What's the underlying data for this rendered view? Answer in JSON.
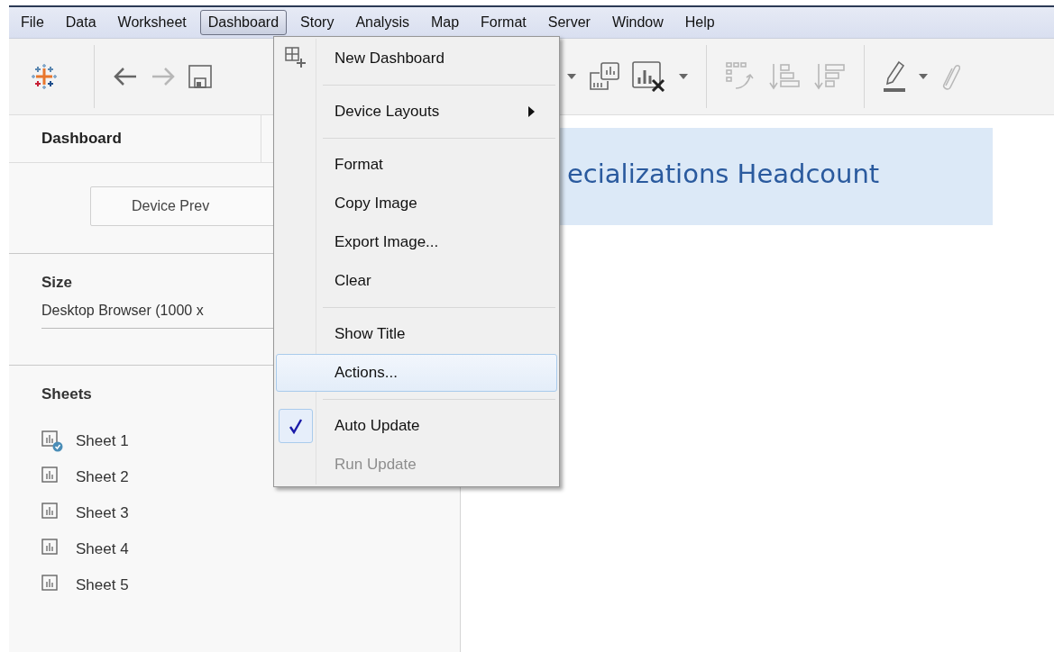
{
  "menubar": [
    {
      "label": "File",
      "selected": false
    },
    {
      "label": "Data",
      "selected": false
    },
    {
      "label": "Worksheet",
      "selected": false
    },
    {
      "label": "Dashboard",
      "selected": true
    },
    {
      "label": "Story",
      "selected": false
    },
    {
      "label": "Analysis",
      "selected": false
    },
    {
      "label": "Map",
      "selected": false
    },
    {
      "label": "Format",
      "selected": false
    },
    {
      "label": "Server",
      "selected": false
    },
    {
      "label": "Window",
      "selected": false
    },
    {
      "label": "Help",
      "selected": false
    }
  ],
  "toolbar_left": [
    {
      "kind": "logo"
    },
    {
      "kind": "separator"
    },
    {
      "kind": "back",
      "disabled": false
    },
    {
      "kind": "forward",
      "disabled": true
    },
    {
      "kind": "save",
      "disabled": false
    }
  ],
  "toolbar_right": [
    {
      "kind": "caret",
      "disabled": false
    },
    {
      "kind": "duplicate",
      "disabled": false
    },
    {
      "kind": "clear",
      "disabled": false
    },
    {
      "kind": "caret",
      "disabled": false
    },
    {
      "kind": "separator"
    },
    {
      "kind": "swap",
      "disabled": true
    },
    {
      "kind": "sort-asc",
      "disabled": true
    },
    {
      "kind": "sort-desc",
      "disabled": true
    },
    {
      "kind": "separator"
    },
    {
      "kind": "pen",
      "disabled": false
    },
    {
      "kind": "caret",
      "disabled": false
    },
    {
      "kind": "clip",
      "disabled": true
    }
  ],
  "sidebar": {
    "tabs": [
      {
        "label": "Dashboard",
        "selected": true
      }
    ],
    "device_preview_button": "Device Prev",
    "size_title": "Size",
    "size_value": "Desktop Browser (1000 x",
    "sheets_title": "Sheets",
    "sheets": [
      {
        "label": "Sheet 1",
        "active": true
      },
      {
        "label": "Sheet 2",
        "active": false
      },
      {
        "label": "Sheet 3",
        "active": false
      },
      {
        "label": "Sheet 4",
        "active": false
      },
      {
        "label": "Sheet 5",
        "active": false
      }
    ]
  },
  "canvas": {
    "title": "ecializations Headcount"
  },
  "dashboard_menu": [
    {
      "kind": "item",
      "label": "New Dashboard",
      "icon": true,
      "submenu": false,
      "selected": false,
      "checked": false,
      "disabled": false
    },
    {
      "kind": "separator"
    },
    {
      "kind": "item",
      "label": "Device Layouts",
      "icon": false,
      "submenu": true,
      "selected": false,
      "checked": false,
      "disabled": false
    },
    {
      "kind": "separator"
    },
    {
      "kind": "item",
      "label": "Format",
      "icon": false,
      "submenu": false,
      "selected": false,
      "checked": false,
      "disabled": false
    },
    {
      "kind": "item",
      "label": "Copy Image",
      "icon": false,
      "submenu": false,
      "selected": false,
      "checked": false,
      "disabled": false
    },
    {
      "kind": "item",
      "label": "Export Image...",
      "icon": false,
      "submenu": false,
      "selected": false,
      "checked": false,
      "disabled": false
    },
    {
      "kind": "item",
      "label": "Clear",
      "icon": false,
      "submenu": false,
      "selected": false,
      "checked": false,
      "disabled": false
    },
    {
      "kind": "separator"
    },
    {
      "kind": "item",
      "label": "Show Title",
      "icon": false,
      "submenu": false,
      "selected": false,
      "checked": false,
      "disabled": false
    },
    {
      "kind": "item",
      "label": "Actions...",
      "icon": false,
      "submenu": false,
      "selected": true,
      "checked": false,
      "disabled": false
    },
    {
      "kind": "separator"
    },
    {
      "kind": "item",
      "label": "Auto Update",
      "icon": false,
      "submenu": false,
      "selected": false,
      "checked": true,
      "disabled": false
    },
    {
      "kind": "item",
      "label": "Run Update",
      "icon": false,
      "submenu": false,
      "selected": false,
      "checked": false,
      "disabled": true
    }
  ]
}
